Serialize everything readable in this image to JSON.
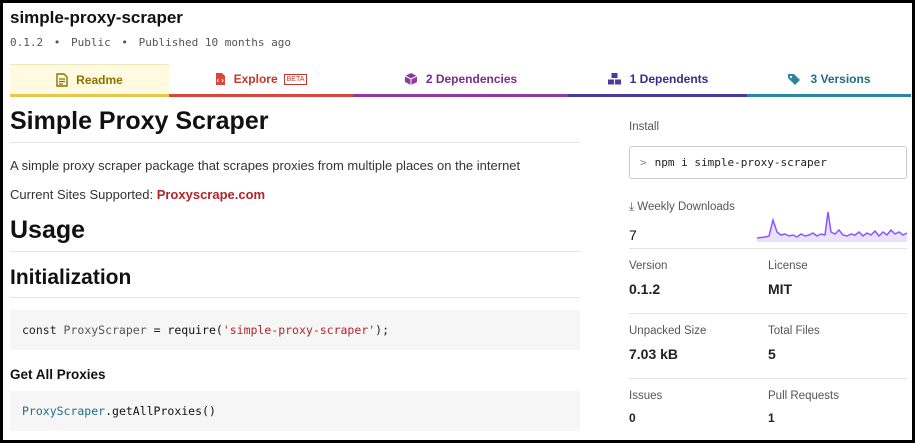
{
  "package": {
    "name": "simple-proxy-scraper",
    "version": "0.1.2",
    "visibility": "Public",
    "published": "Published 10 months ago"
  },
  "tabs": [
    {
      "label": "Readme"
    },
    {
      "label": "Explore",
      "badge": "BETA"
    },
    {
      "label": "2  Dependencies"
    },
    {
      "label": "1  Dependents"
    },
    {
      "label": "3  Versions"
    }
  ],
  "readme": {
    "title": "Simple Proxy Scraper",
    "description": "A simple proxy scraper package that scrapes proxies from multiple places on the internet",
    "sites_prefix": "Current Sites Supported: ",
    "sites_link": "Proxyscrape.com",
    "usage_heading": "Usage",
    "init_heading": "Initialization",
    "code_init": {
      "keyword": "const ",
      "var": "ProxyScraper",
      "op": " = ",
      "fn": "require(",
      "str": "'simple-proxy-scraper'",
      "end": ");"
    },
    "get_all_heading": "Get All Proxies",
    "code_get_all": {
      "obj": "ProxyScraper",
      "method": ".getAllProxies()"
    }
  },
  "sidebar": {
    "install_label": "Install",
    "install_command": "npm i simple-proxy-scraper",
    "weekly_label": "Weekly Downloads",
    "weekly_count": "7",
    "accent": "#8956ff",
    "stats": [
      {
        "label": "Version",
        "value": "0.1.2"
      },
      {
        "label": "License",
        "value": "MIT"
      },
      {
        "label": "Unpacked Size",
        "value": "7.03 kB"
      },
      {
        "label": "Total Files",
        "value": "5"
      },
      {
        "label": "Issues",
        "value": "0"
      },
      {
        "label": "Pull Requests",
        "value": "1"
      }
    ]
  }
}
